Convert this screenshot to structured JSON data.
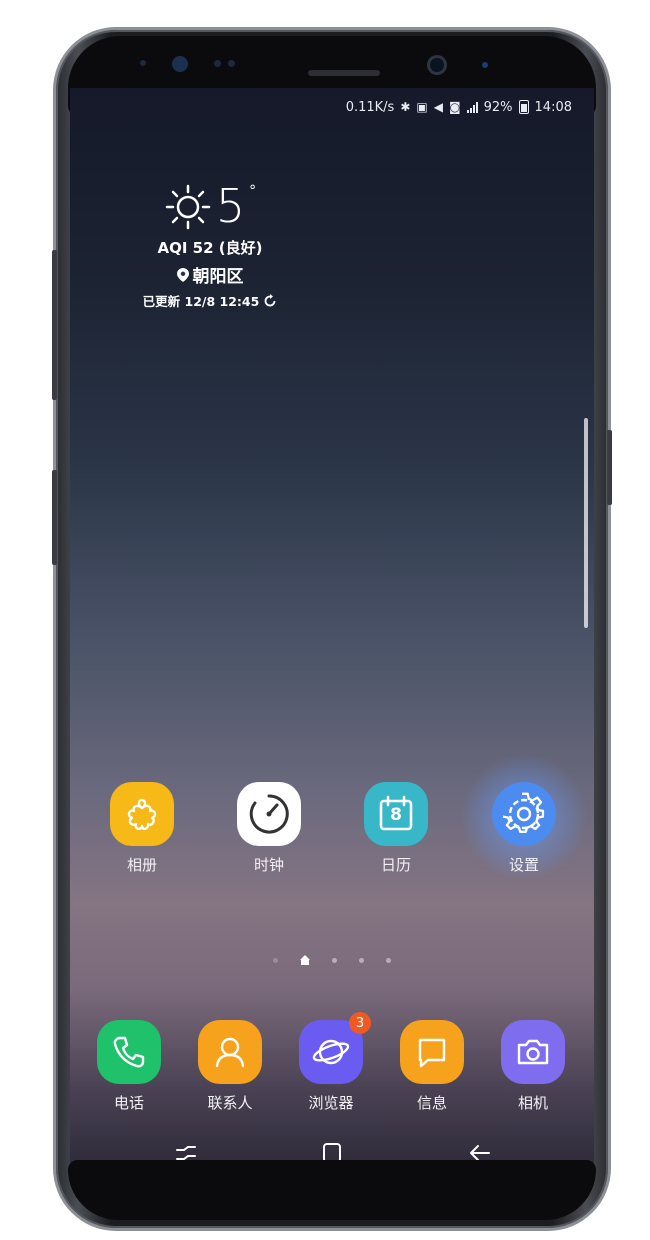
{
  "status_bar": {
    "speed": "0.11K/s",
    "battery": "92%",
    "time": "14:08"
  },
  "weather": {
    "temperature": "5",
    "degree": "°",
    "aqi": "AQI 52 (良好)",
    "location": "朝阳区",
    "updated": "已更新 12/8 12:45"
  },
  "apps": [
    {
      "label": "相册",
      "color": "#f7b917"
    },
    {
      "label": "时钟",
      "color": "#ffffff"
    },
    {
      "label": "日历",
      "color": "#38b7c9",
      "date": "8"
    },
    {
      "label": "设置",
      "color": "#4c8bf0"
    }
  ],
  "dock": [
    {
      "label": "电话",
      "color": "#1fc16b"
    },
    {
      "label": "联系人",
      "color": "#f7a21c"
    },
    {
      "label": "浏览器",
      "color": "#6a5cf0",
      "badge": "3"
    },
    {
      "label": "信息",
      "color": "#f7a21c"
    },
    {
      "label": "相机",
      "color": "#7f6df0"
    }
  ]
}
